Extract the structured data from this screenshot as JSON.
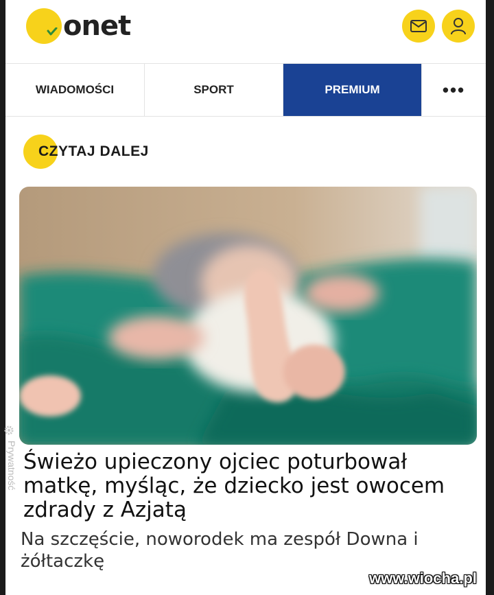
{
  "header": {
    "logo_text": "onet",
    "mail_icon": "mail-icon",
    "user_icon": "user-icon"
  },
  "nav": {
    "items": [
      {
        "label": "WIADOMOŚCI"
      },
      {
        "label": "SPORT"
      },
      {
        "label": "PREMIUM"
      }
    ],
    "more_label": "•••"
  },
  "section": {
    "label": "CZYTAJ DALEJ"
  },
  "article": {
    "headline": "Świeżo upieczony ojciec poturbował matkę, myśląc, że dziecko jest owocem zdrady z Azjatą",
    "lead": "Na szczęście, noworodek ma zespół Downa i żółtaczkę"
  },
  "side": {
    "privacy_label": "Prywatność"
  },
  "watermark": "www.wiocha.pl",
  "colors": {
    "brand_yellow": "#f7d21b",
    "premium_blue": "#1a4294"
  }
}
